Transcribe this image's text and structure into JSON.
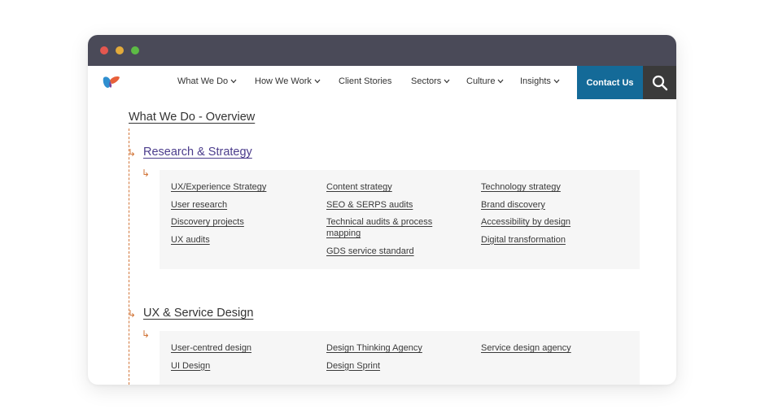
{
  "nav": {
    "items": [
      {
        "label": "What We Do",
        "dropdown": true
      },
      {
        "label": "How We Work",
        "dropdown": true
      },
      {
        "label": "Client Stories",
        "dropdown": false
      },
      {
        "label": "Sectors",
        "dropdown": true
      },
      {
        "label": "Culture",
        "dropdown": true
      },
      {
        "label": "Insights",
        "dropdown": true
      }
    ],
    "contact_label": "Contact Us"
  },
  "page": {
    "overview_title": "What We Do - Overview",
    "sections": [
      {
        "title": "Research & Strategy",
        "columns": [
          [
            "UX/Experience Strategy",
            "User research",
            "Discovery projects",
            "UX audits"
          ],
          [
            "Content strategy",
            "SEO & SERPS audits",
            "Technical audits & process mapping",
            "GDS service standard"
          ],
          [
            "Technology strategy",
            "Brand discovery",
            "Accessibility by design",
            "Digital transformation"
          ]
        ]
      },
      {
        "title": "UX & Service Design",
        "columns": [
          [
            "User-centred design",
            "UI Design"
          ],
          [
            "Design Thinking Agency",
            "Design Sprint"
          ],
          [
            "Service design agency"
          ]
        ]
      }
    ]
  },
  "colors": {
    "titlebar": "#4a4a58",
    "contact": "#146a98",
    "search": "#3a3a3a",
    "accent_line": "#d2763a",
    "visited_link": "#4b3c8c",
    "panel": "#f6f6f6"
  },
  "icons": {
    "logo": "brand-logo-icon",
    "search": "search-icon",
    "chevron": "chevron-down-icon",
    "arrow": "return-arrow-icon"
  }
}
